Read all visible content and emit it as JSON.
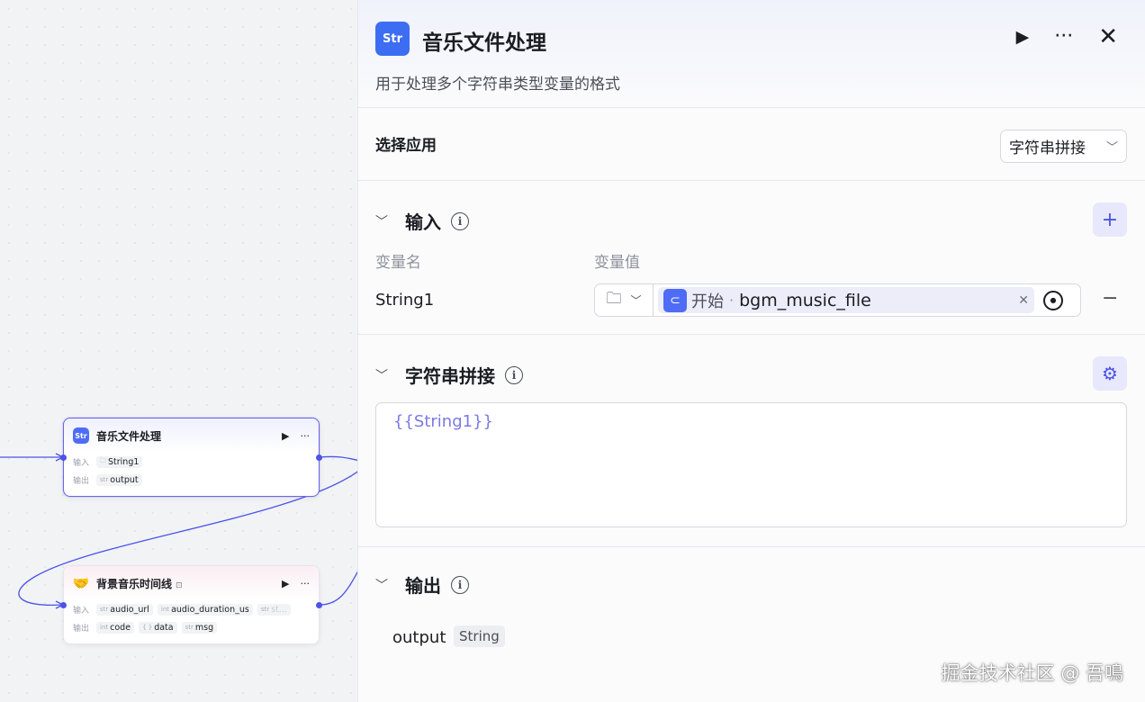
{
  "canvas": {
    "nodes": [
      {
        "title": "音乐文件处理",
        "icon_text": "Str",
        "input_label": "输入",
        "output_label": "输出",
        "inputs": [
          {
            "type": "folder",
            "name": "String1"
          }
        ],
        "outputs": [
          {
            "type": "str",
            "name": "output"
          }
        ]
      },
      {
        "title": "背景音乐时间线",
        "icon_text": "🤝",
        "input_label": "输入",
        "output_label": "输出",
        "inputs": [
          {
            "type": "str",
            "name": "audio_url"
          },
          {
            "type": "int",
            "name": "audio_duration_us"
          },
          {
            "type": "str",
            "name": "st..."
          }
        ],
        "outputs": [
          {
            "type": "int",
            "name": "code"
          },
          {
            "type": "{ }",
            "name": "data"
          },
          {
            "type": "str",
            "name": "msg"
          }
        ]
      }
    ],
    "accent": "#4d53e8"
  },
  "panel": {
    "icon_text": "Str",
    "title": "音乐文件处理",
    "description": "用于处理多个字符串类型变量的格式",
    "actions": {
      "run": "▶",
      "more": "···",
      "close": "✕"
    },
    "select": {
      "label": "选择应用",
      "value": "字符串拼接",
      "chevron": "⌄"
    },
    "input_section": {
      "title": "输入",
      "add": "+",
      "col_name": "变量名",
      "col_value": "变量值",
      "row": {
        "name": "String1",
        "source": "开始",
        "variable": "bgm_music_file",
        "remove": "−"
      }
    },
    "concat_section": {
      "title": "字符串拼接",
      "template": "{{String1}}"
    },
    "output_section": {
      "title": "输出",
      "name": "output",
      "type": "String"
    }
  },
  "watermark": "掘金技术社区 @ 吾鳴"
}
